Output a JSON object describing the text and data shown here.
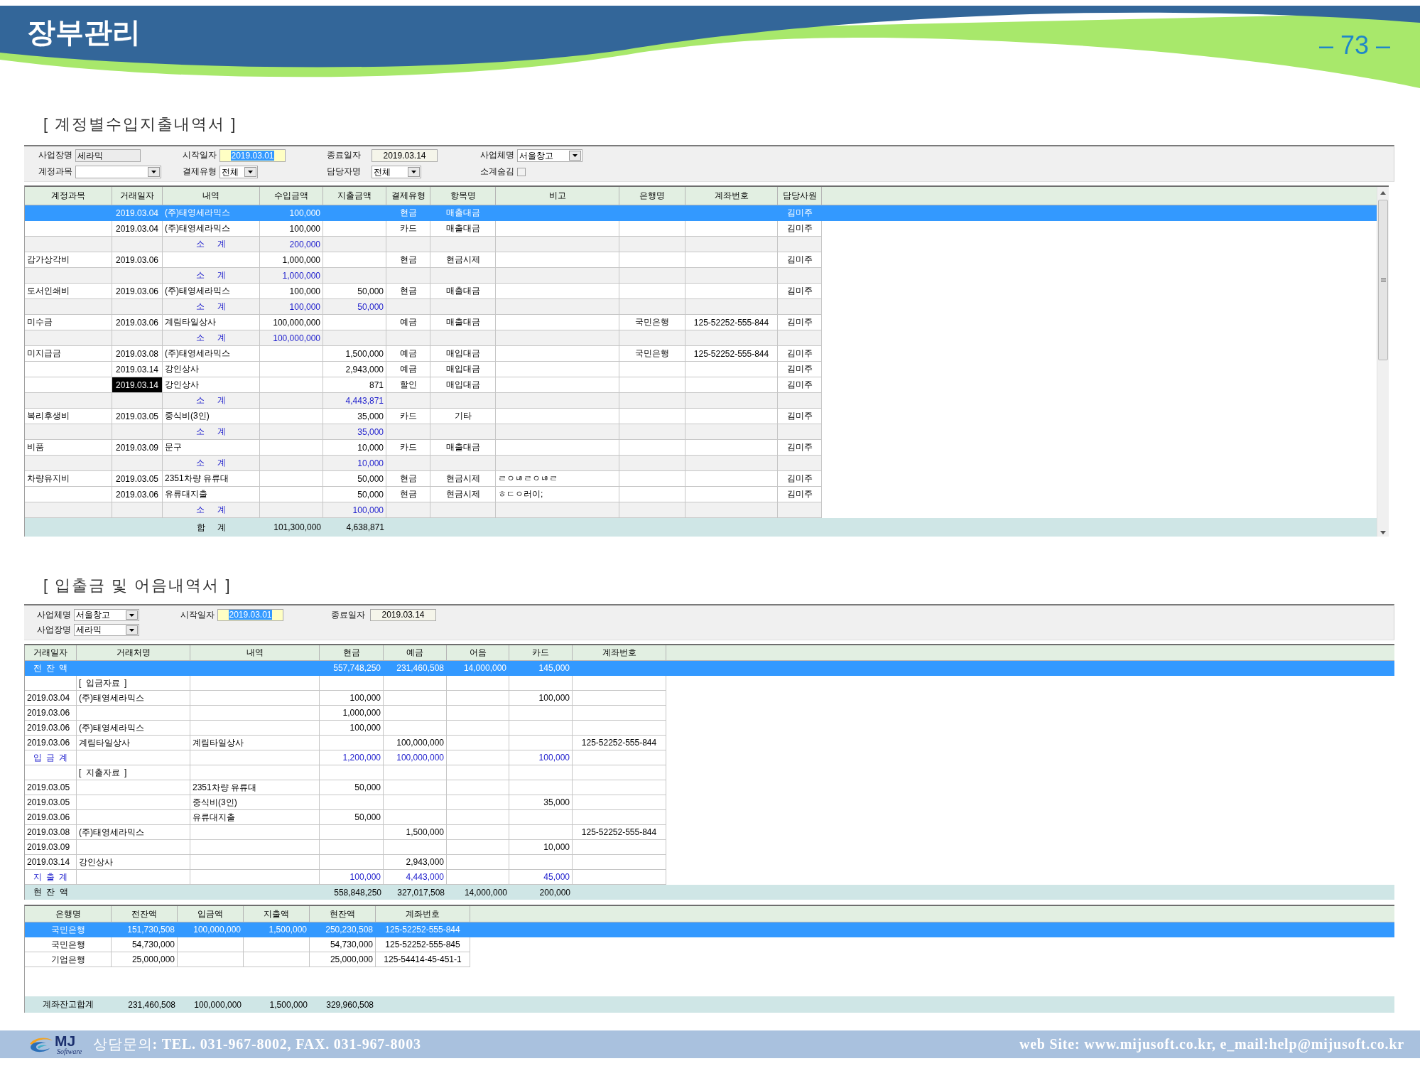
{
  "page_header": {
    "title": "장부관리",
    "page_number": "– 73 –"
  },
  "income_expense_report": {
    "heading": "[ 계정별수입지출내역서 ]",
    "filters": [
      {
        "kind": "text",
        "label": "사업장명",
        "value": "세라믹",
        "focused": false
      },
      {
        "kind": "date",
        "label": "시작일자",
        "value": "2019.03.01",
        "focused": true
      },
      {
        "kind": "date",
        "label": "종료일자",
        "value": "2019.03.14",
        "focused": false
      },
      {
        "kind": "combo",
        "label": "사업체명",
        "value": "서울창고",
        "focused": false
      },
      {
        "kind": "combo",
        "label": "계정과목",
        "focused": false
      },
      {
        "kind": "combo",
        "label": "결제유형",
        "value": "전체",
        "focused": false
      },
      {
        "kind": "combo",
        "label": "담당자명",
        "value": "전체",
        "focused": false
      },
      {
        "kind": "checkbox",
        "label": "소계숨김",
        "checked": false,
        "focused": false
      }
    ],
    "columns": [
      "계정과목",
      "거래일자",
      "내역",
      "수입금액",
      "지출금액",
      "결제유형",
      "항목명",
      "비고",
      "은행명",
      "계좌번호",
      "담당사원"
    ],
    "rows": [
      {
        "kind": "entry",
        "selected": true,
        "date_focused": false,
        "date": "2019.03.04",
        "description": "(주)태영세라믹스",
        "income": "100,000",
        "payment_type": "현금",
        "item": "매출대금",
        "staff": "김미주"
      },
      {
        "kind": "entry",
        "selected": false,
        "date_focused": false,
        "date": "2019.03.04",
        "description": "(주)태영세라믹스",
        "income": "100,000",
        "payment_type": "카드",
        "item": "매출대금",
        "staff": "김미주"
      },
      {
        "kind": "subtotal",
        "selected": false,
        "date_focused": false,
        "label": "소 계",
        "income": "200,000"
      },
      {
        "kind": "entry",
        "selected": false,
        "date_focused": false,
        "account": "감가상각비",
        "date": "2019.03.06",
        "income": "1,000,000",
        "payment_type": "현금",
        "item": "현금시제",
        "staff": "김미주"
      },
      {
        "kind": "subtotal",
        "selected": false,
        "date_focused": false,
        "label": "소 계",
        "income": "1,000,000"
      },
      {
        "kind": "entry",
        "selected": false,
        "date_focused": false,
        "account": "도서인쇄비",
        "date": "2019.03.06",
        "description": "(주)태영세라믹스",
        "income": "100,000",
        "expense": "50,000",
        "payment_type": "현금",
        "item": "매출대금",
        "staff": "김미주"
      },
      {
        "kind": "subtotal",
        "selected": false,
        "date_focused": false,
        "label": "소 계",
        "income": "100,000",
        "expense": "50,000"
      },
      {
        "kind": "entry",
        "selected": false,
        "date_focused": false,
        "account": "미수금",
        "date": "2019.03.06",
        "description": "계림타일상사",
        "income": "100,000,000",
        "payment_type": "예금",
        "item": "매출대금",
        "bank": "국민은행",
        "account_number": "125-52252-555-844",
        "staff": "김미주"
      },
      {
        "kind": "subtotal",
        "selected": false,
        "date_focused": false,
        "label": "소 계",
        "income": "100,000,000"
      },
      {
        "kind": "entry",
        "selected": false,
        "date_focused": false,
        "account": "미지급금",
        "date": "2019.03.08",
        "description": "(주)태영세라믹스",
        "expense": "1,500,000",
        "payment_type": "예금",
        "item": "매입대금",
        "bank": "국민은행",
        "account_number": "125-52252-555-844",
        "staff": "김미주"
      },
      {
        "kind": "entry",
        "selected": false,
        "date_focused": false,
        "date": "2019.03.14",
        "description": "강인상사",
        "expense": "2,943,000",
        "payment_type": "예금",
        "item": "매입대금",
        "staff": "김미주"
      },
      {
        "kind": "entry",
        "selected": false,
        "date_focused": true,
        "date": "2019.03.14",
        "description": "강인상사",
        "expense": "871",
        "payment_type": "할인",
        "item": "매입대금",
        "staff": "김미주"
      },
      {
        "kind": "subtotal",
        "selected": false,
        "date_focused": false,
        "label": "소 계",
        "expense": "4,443,871"
      },
      {
        "kind": "entry",
        "selected": false,
        "date_focused": false,
        "account": "복리후생비",
        "date": "2019.03.05",
        "description": "중식비(3인)",
        "expense": "35,000",
        "payment_type": "카드",
        "item": "기타",
        "staff": "김미주"
      },
      {
        "kind": "subtotal",
        "selected": false,
        "date_focused": false,
        "label": "소 계",
        "expense": "35,000"
      },
      {
        "kind": "entry",
        "selected": false,
        "date_focused": false,
        "account": "비품",
        "date": "2019.03.09",
        "description": "문구",
        "expense": "10,000",
        "payment_type": "카드",
        "item": "매출대금",
        "staff": "김미주"
      },
      {
        "kind": "subtotal",
        "selected": false,
        "date_focused": false,
        "label": "소 계",
        "expense": "10,000"
      },
      {
        "kind": "entry",
        "selected": false,
        "date_focused": false,
        "account": "차량유지비",
        "date": "2019.03.05",
        "description": "2351차량 유류대",
        "expense": "50,000",
        "payment_type": "현금",
        "item": "현금시제",
        "note": "ㄹㅇㄶㄹㅇㄶㄹ",
        "staff": "김미주"
      },
      {
        "kind": "entry",
        "selected": false,
        "date_focused": false,
        "date": "2019.03.06",
        "description": "유류대지출",
        "expense": "50,000",
        "payment_type": "현금",
        "item": "현금시제",
        "note": "ㅎㄷㅇ러이;",
        "staff": "김미주"
      },
      {
        "kind": "subtotal",
        "selected": false,
        "date_focused": false,
        "label": "소 계",
        "expense": "100,000"
      }
    ],
    "total": {
      "label": "합 계",
      "income": "101,300,000",
      "expense": "4,638,871"
    }
  },
  "cash_and_bill_report": {
    "heading": "[ 입출금 및 어음내역서 ]",
    "filters": [
      {
        "kind": "combo",
        "label": "사업체명",
        "value": "서울창고",
        "focused": false
      },
      {
        "kind": "date",
        "label": "시작일자",
        "value": "2019.03.01",
        "focused": true
      },
      {
        "kind": "date",
        "label": "종료일자",
        "value": "2019.03.14",
        "focused": false
      },
      {
        "kind": "combo",
        "label": "사업장명",
        "value": "세라믹",
        "focused": false
      }
    ],
    "columns": [
      "거래일자",
      "거래처명",
      "내역",
      "현금",
      "예금",
      "어음",
      "카드",
      "계좌번호"
    ],
    "rows": [
      {
        "kind": "balance",
        "selected": true,
        "label": "전 잔 액",
        "cash": "557,748,250",
        "deposit": "231,460,508",
        "bill": "14,000,000",
        "card": "145,000"
      },
      {
        "kind": "group",
        "selected": false,
        "label": "[ 입금자료 ]"
      },
      {
        "kind": "entry",
        "selected": false,
        "date": "2019.03.04",
        "partner": "(주)태영세라믹스",
        "cash": "100,000",
        "card": "100,000"
      },
      {
        "kind": "entry",
        "selected": false,
        "date": "2019.03.06",
        "cash": "1,000,000"
      },
      {
        "kind": "entry",
        "selected": false,
        "date": "2019.03.06",
        "partner": "(주)태영세라믹스",
        "cash": "100,000"
      },
      {
        "kind": "entry",
        "selected": false,
        "date": "2019.03.06",
        "partner": "계림타일상사",
        "description": "계림타일상사",
        "deposit": "100,000,000",
        "account_number": "125-52252-555-844"
      },
      {
        "kind": "subtotal",
        "selected": false,
        "label": "입 금 계",
        "cash": "1,200,000",
        "deposit": "100,000,000",
        "card": "100,000"
      },
      {
        "kind": "group",
        "selected": false,
        "label": "[ 지출자료 ]"
      },
      {
        "kind": "entry",
        "selected": false,
        "date": "2019.03.05",
        "description": "2351차량 유류대",
        "cash": "50,000"
      },
      {
        "kind": "entry",
        "selected": false,
        "date": "2019.03.05",
        "description": "중식비(3인)",
        "card": "35,000"
      },
      {
        "kind": "entry",
        "selected": false,
        "date": "2019.03.06",
        "description": "유류대지출",
        "cash": "50,000"
      },
      {
        "kind": "entry",
        "selected": false,
        "date": "2019.03.08",
        "partner": "(주)태영세라믹스",
        "deposit": "1,500,000",
        "account_number": "125-52252-555-844"
      },
      {
        "kind": "entry",
        "selected": false,
        "date": "2019.03.09",
        "card": "10,000"
      },
      {
        "kind": "entry",
        "selected": false,
        "date": "2019.03.14",
        "partner": "강인상사",
        "deposit": "2,943,000"
      },
      {
        "kind": "subtotal",
        "selected": false,
        "label": "지 출 계",
        "cash": "100,000",
        "deposit": "4,443,000",
        "card": "45,000"
      }
    ],
    "total": {
      "label": "현 잔 액",
      "cash": "558,848,250",
      "deposit": "327,017,508",
      "bill": "14,000,000",
      "card": "200,000"
    },
    "bank_balances": {
      "columns": [
        "은행명",
        "전잔액",
        "입금액",
        "지출액",
        "현잔액",
        "계좌번호"
      ],
      "rows": [
        {
          "selected": true,
          "bank": "국민은행",
          "opening": "151,730,508",
          "deposits": "100,000,000",
          "withdrawals": "1,500,000",
          "balance": "250,230,508",
          "account_number": "125-52252-555-844"
        },
        {
          "selected": false,
          "bank": "국민은행",
          "opening": "54,730,000",
          "balance": "54,730,000",
          "account_number": "125-52252-555-845"
        },
        {
          "selected": false,
          "bank": "기업은행",
          "opening": "25,000,000",
          "balance": "25,000,000",
          "account_number": "125-54414-45-451-1"
        }
      ],
      "total": {
        "label": "계좌잔고합계",
        "opening": "231,460,508",
        "deposits": "100,000,000",
        "withdrawals": "1,500,000",
        "balance": "329,960,508"
      }
    }
  },
  "footer": {
    "logo": {
      "name": "MJ",
      "tagline": "Software"
    },
    "contact": "상담문의**: TEL. 031-967-8002, FAX. 031-967-8003**",
    "web": "web Site: www.mijusoft.co.kr, e_mail:help@mijusoft.co.kr"
  }
}
